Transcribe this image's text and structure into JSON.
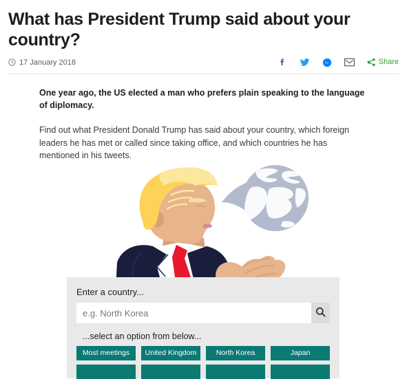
{
  "article": {
    "headline": "What has President Trump said about your country?",
    "date": "17 January 2018",
    "date_icon": "clock-icon",
    "standfirst": "One year ago, the US elected a man who prefers plain speaking to the language of diplomacy.",
    "intro": "Find out what President Donald Trump has said about your country, which foreign leaders he has met or called since taking office, and which countries he has mentioned in his tweets."
  },
  "share": {
    "items": [
      {
        "icon": "facebook-icon",
        "label": "",
        "color": "#3b5998"
      },
      {
        "icon": "twitter-icon",
        "label": "",
        "color": "#1da1f2"
      },
      {
        "icon": "messenger-icon",
        "label": "",
        "color": "#0084ff"
      },
      {
        "icon": "email-icon",
        "label": "",
        "color": "#4a4a4a"
      },
      {
        "icon": "share-icon",
        "label": "Share",
        "color": "#3aa23a"
      }
    ]
  },
  "illustration": {
    "name": "trump-speech-globe-illustration",
    "alt": "Illustration of President Trump in profile speaking, with a globe shaped like a speech bubble",
    "colors": {
      "hair": "#fcd257",
      "hair_light": "#fde79c",
      "skin": "#e7b48b",
      "skin_shadow": "#d9a077",
      "suit": "#191e3c",
      "shirt": "#ffffff",
      "tie": "#e8192c",
      "globe": "#b3bace",
      "globe_land": "#ffffff"
    }
  },
  "selector": {
    "label": "Enter a country...",
    "placeholder": "e.g. North Korea",
    "value": "",
    "search_icon": "search-icon",
    "sublabel": "...select an option from below...",
    "accent_color": "#0b7a73",
    "panel_color": "#e9e9e9",
    "options": [
      "Most meetings",
      "United Kingdom",
      "North Korea",
      "Japan"
    ],
    "options_row2": [
      "",
      "",
      "",
      ""
    ]
  }
}
